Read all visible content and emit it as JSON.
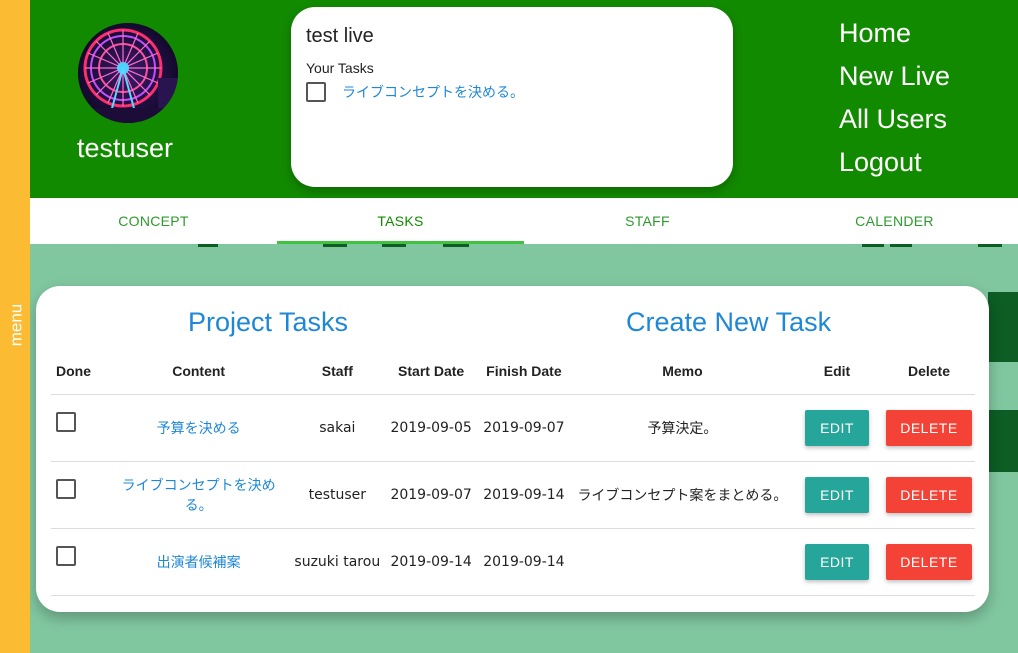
{
  "rail": {
    "label": "menu"
  },
  "profile": {
    "username": "testuser"
  },
  "live": {
    "title": "test live",
    "tasks_heading": "Your Tasks",
    "tasks": [
      {
        "label": "ライブコンセプトを決める。",
        "done": false
      }
    ]
  },
  "nav": {
    "items": [
      "Home",
      "New Live",
      "All Users",
      "Logout"
    ]
  },
  "tabs": {
    "items": [
      "CONCEPT",
      "TASKS",
      "STAFF",
      "CALENDER"
    ],
    "active": "TASKS"
  },
  "tasks_panel": {
    "title": "Project Tasks",
    "create_link": "Create New Task",
    "headers": [
      "Done",
      "Content",
      "Staff",
      "Start Date",
      "Finish Date",
      "Memo",
      "Edit",
      "Delete"
    ],
    "rows": [
      {
        "done": false,
        "content": "予算を決める",
        "staff": "sakai",
        "start": "2019-09-05",
        "finish": "2019-09-07",
        "memo": "予算決定。",
        "edit": "EDIT",
        "delete": "DELETE"
      },
      {
        "done": false,
        "content": "ライブコンセプトを決める。",
        "staff": "testuser",
        "start": "2019-09-07",
        "finish": "2019-09-14",
        "memo": "ライブコンセプト案をまとめる。",
        "edit": "EDIT",
        "delete": "DELETE"
      },
      {
        "done": false,
        "content": "出演者候補案",
        "staff": "suzuki tarou",
        "start": "2019-09-14",
        "finish": "2019-09-14",
        "memo": "",
        "edit": "EDIT",
        "delete": "DELETE"
      }
    ]
  },
  "colors": {
    "header_green": "#128a00",
    "rail_yellow": "#fbbb33",
    "page_bg": "#80c7a0",
    "link_blue": "#1e88d6",
    "edit_teal": "#26a69a",
    "delete_red": "#f44336"
  }
}
